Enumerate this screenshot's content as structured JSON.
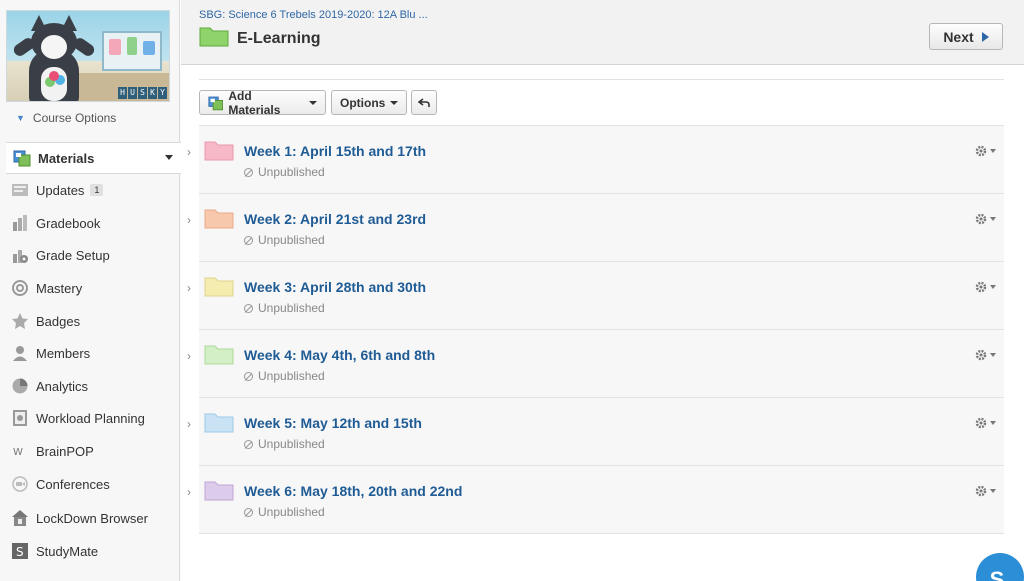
{
  "breadcrumb": "SBG: Science 6 Trebels 2019-2020: 12A Blu ...",
  "page_title": "E-Learning",
  "next_label": "Next",
  "course_image_text": [
    "H",
    "U",
    "S",
    "K",
    "Y"
  ],
  "course_options_label": "Course Options",
  "sidebar": {
    "items": [
      {
        "label": "Materials",
        "icon": "materials-icon",
        "active": true
      },
      {
        "label": "Updates",
        "icon": "updates-icon",
        "badge": "1"
      },
      {
        "label": "Gradebook",
        "icon": "gradebook-icon"
      },
      {
        "label": "Grade Setup",
        "icon": "grade-setup-icon"
      },
      {
        "label": "Mastery",
        "icon": "mastery-icon"
      },
      {
        "label": "Badges",
        "icon": "badges-icon"
      },
      {
        "label": "Members",
        "icon": "members-icon"
      },
      {
        "label": "Analytics",
        "icon": "analytics-icon"
      },
      {
        "label": "Workload Planning",
        "icon": "workload-icon"
      },
      {
        "label": "BrainPOP",
        "icon": "brainpop-icon"
      },
      {
        "label": "Conferences",
        "icon": "conferences-icon"
      },
      {
        "label": "LockDown Browser",
        "icon": "lockdown-icon"
      },
      {
        "label": "StudyMate",
        "icon": "studymate-icon"
      }
    ]
  },
  "toolbar": {
    "add_materials_label": "Add Materials",
    "options_label": "Options"
  },
  "folders": [
    {
      "title": "Week 1: April 15th and 17th",
      "status": "Unpublished",
      "color": "#f7b8c8"
    },
    {
      "title": "Week 2: April 21st and 23rd",
      "status": "Unpublished",
      "color": "#f8c8ad"
    },
    {
      "title": "Week 3: April 28th and 30th",
      "status": "Unpublished",
      "color": "#f5ecb0"
    },
    {
      "title": "Week 4: May 4th, 6th and 8th",
      "status": "Unpublished",
      "color": "#d3efc6"
    },
    {
      "title": "Week 5: May 12th and 15th",
      "status": "Unpublished",
      "color": "#c9e3f5"
    },
    {
      "title": "Week 6: May 18th, 20th and 22nd",
      "status": "Unpublished",
      "color": "#dccbea"
    }
  ],
  "avatar_letter": "S",
  "colors": {
    "link_blue": "#1f5b94",
    "title_folder_green": "#8fd36b",
    "avatar_blue": "#2b8ed6"
  }
}
